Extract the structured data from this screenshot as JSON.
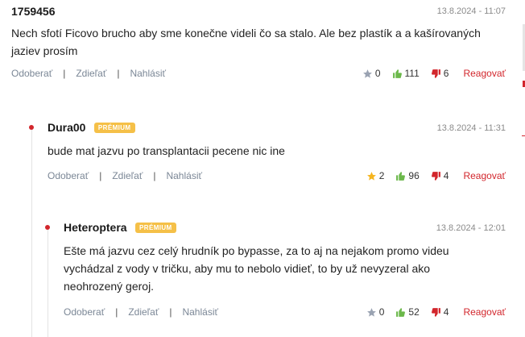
{
  "comments": [
    {
      "author": "1759456",
      "badge": "",
      "timestamp": "13.8.2024 - 11:07",
      "text": "Nech sfotí Ficovo brucho aby sme konečne videli čo sa stalo. Ale bez plastík a a kašírovaných jaziev prosím",
      "actions": {
        "unfollow": "Odoberať",
        "share": "Zdieľať",
        "report": "Nahlásiť"
      },
      "stars": "0",
      "likes": "111",
      "dislikes": "6",
      "reply": "Reagovať"
    },
    {
      "author": "Dura00",
      "badge": "PRÉMIUM",
      "timestamp": "13.8.2024 - 11:31",
      "text": "bude mat jazvu po transplantacii pecene nic ine",
      "actions": {
        "unfollow": "Odoberať",
        "share": "Zdieľať",
        "report": "Nahlásiť"
      },
      "stars": "2",
      "likes": "96",
      "dislikes": "4",
      "reply": "Reagovať"
    },
    {
      "author": "Heteroptera",
      "badge": "PRÉMIUM",
      "timestamp": "13.8.2024 - 12:01",
      "text": "Ešte má jazvu cez celý hrudník po bypasse, za to aj na nejakom promo videu vychádzal z vody v tričku, aby mu to nebolo vidieť, to by už nevyzeral ako neohrozený geroj.",
      "actions": {
        "unfollow": "Odoberať",
        "share": "Zdieľať",
        "report": "Nahlásiť"
      },
      "stars": "0",
      "likes": "52",
      "dislikes": "4",
      "reply": "Reagovať"
    }
  ],
  "colors": {
    "accent": "#d2262c",
    "badge": "#f5c048",
    "like": "#6bb84a",
    "star_active": "#f5b520",
    "star_inactive": "#9aa3b2"
  }
}
